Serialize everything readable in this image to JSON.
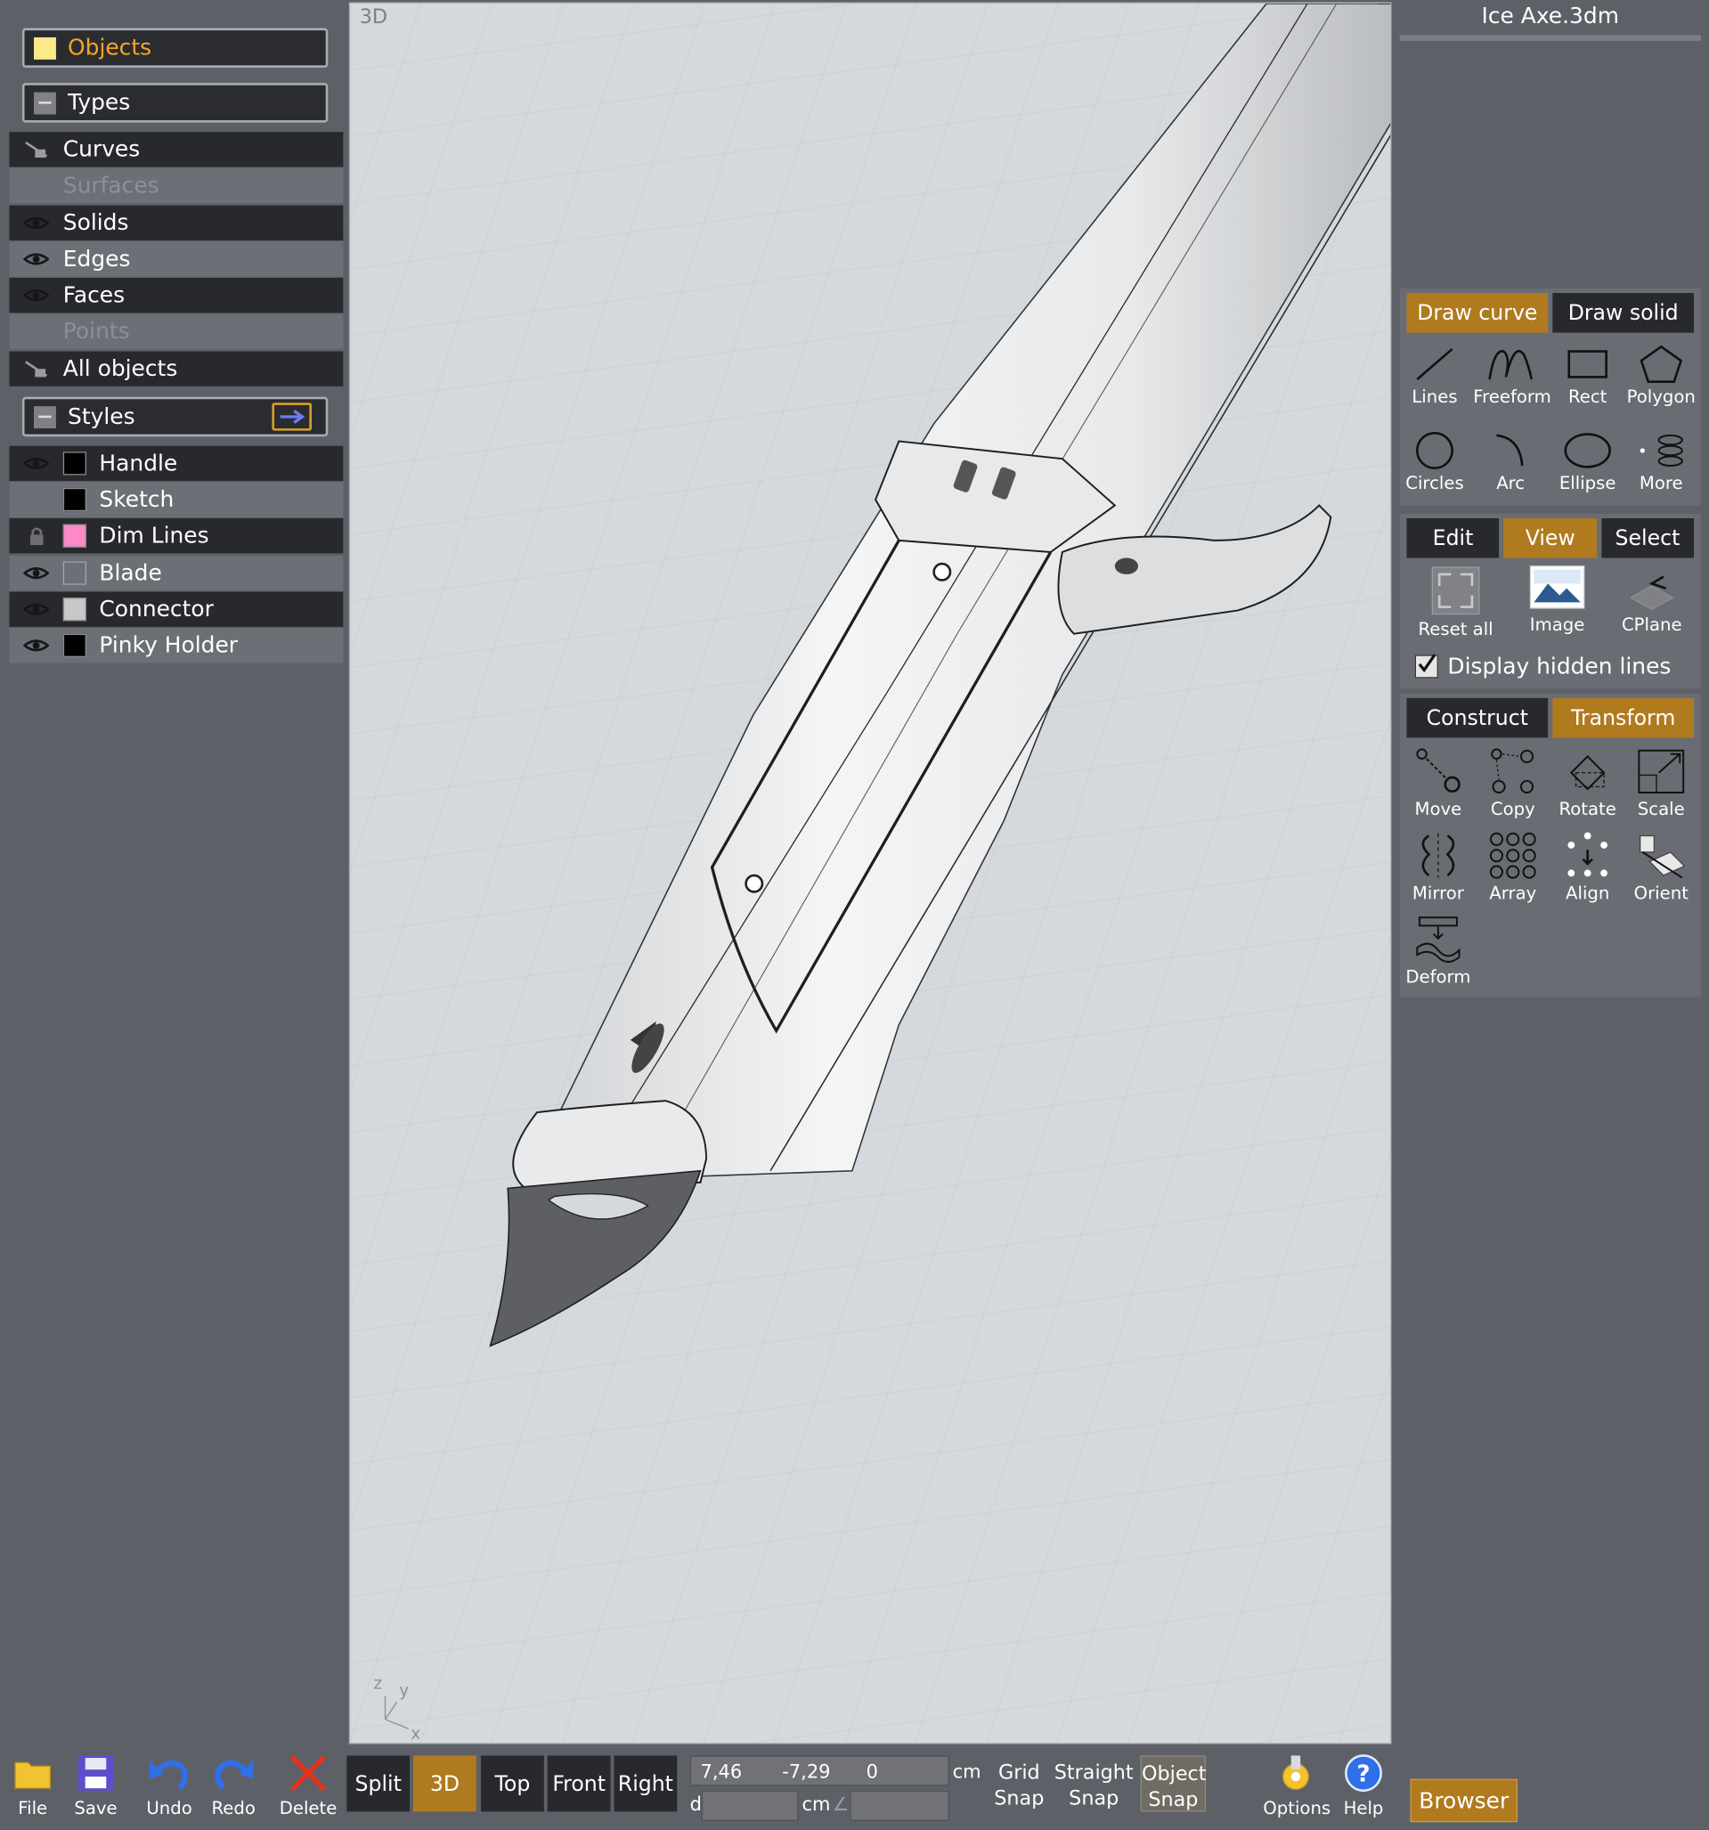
{
  "panel": {
    "objects_label": "Objects",
    "types_label": "Types",
    "types": [
      {
        "label": "Curves",
        "visible": true,
        "locked": true
      },
      {
        "label": "Surfaces",
        "visible": false
      },
      {
        "label": "Solids",
        "visible": true
      },
      {
        "label": "Edges",
        "visible": true
      },
      {
        "label": "Faces",
        "visible": true
      },
      {
        "label": "Points",
        "visible": false
      },
      {
        "label": "All objects",
        "visible": true,
        "locked": true
      }
    ],
    "styles_label": "Styles",
    "layers": [
      {
        "label": "Handle",
        "color": "#000000",
        "state": "eye"
      },
      {
        "label": "Sketch",
        "color": "#000000",
        "state": "none"
      },
      {
        "label": "Dim Lines",
        "color": "#ff88c6",
        "state": "lock"
      },
      {
        "label": "Blade",
        "color": "#6d6f76",
        "state": "eye"
      },
      {
        "label": "Connector",
        "color": "#c8c8c8",
        "state": "eye"
      },
      {
        "label": "Pinky Holder",
        "color": "#000000",
        "state": "eye"
      }
    ]
  },
  "viewport": {
    "label": "3D",
    "axes": {
      "z": "z",
      "y": "y",
      "x": "x"
    }
  },
  "file": {
    "title": "Ice Axe.3dm"
  },
  "draw": {
    "tabs": [
      "Draw curve",
      "Draw solid"
    ],
    "active": "Draw curve",
    "tools": [
      "Lines",
      "Freeform",
      "Rect",
      "Polygon",
      "Circles",
      "Arc",
      "Ellipse",
      "More"
    ]
  },
  "edit": {
    "tabs": [
      "Edit",
      "View",
      "Select"
    ],
    "active": "View",
    "tools": [
      "Reset all",
      "Image",
      "CPlane"
    ],
    "display_hidden_lines": "Display hidden lines",
    "display_hidden_checked": true
  },
  "construct": {
    "tabs": [
      "Construct",
      "Transform"
    ],
    "active": "Transform",
    "tools": [
      "Move",
      "Copy",
      "Rotate",
      "Scale",
      "Mirror",
      "Array",
      "Align",
      "Orient",
      "Deform"
    ]
  },
  "bottom": {
    "file_tools": [
      "File",
      "Save",
      "Undo",
      "Redo",
      "Delete"
    ],
    "views": [
      "Split",
      "3D",
      "Top",
      "Front",
      "Right"
    ],
    "active_view": "3D",
    "coords": {
      "x": "7,46",
      "y": "-7,29",
      "z": "0",
      "unit": "cm",
      "d_label": "d",
      "d_unit": "cm",
      "angle_symbol": "∠"
    },
    "snaps": [
      {
        "line1": "Grid",
        "line2": "Snap",
        "active": false
      },
      {
        "line1": "Straight",
        "line2": "Snap",
        "active": false
      },
      {
        "line1": "Object",
        "line2": "Snap",
        "active": true
      }
    ],
    "options_label": "Options",
    "help_label": "Help",
    "browser_label": "Browser"
  },
  "colors": {
    "accent": "#b07a1e",
    "panel": "#5e6068",
    "viewport": "#d4d9de"
  }
}
